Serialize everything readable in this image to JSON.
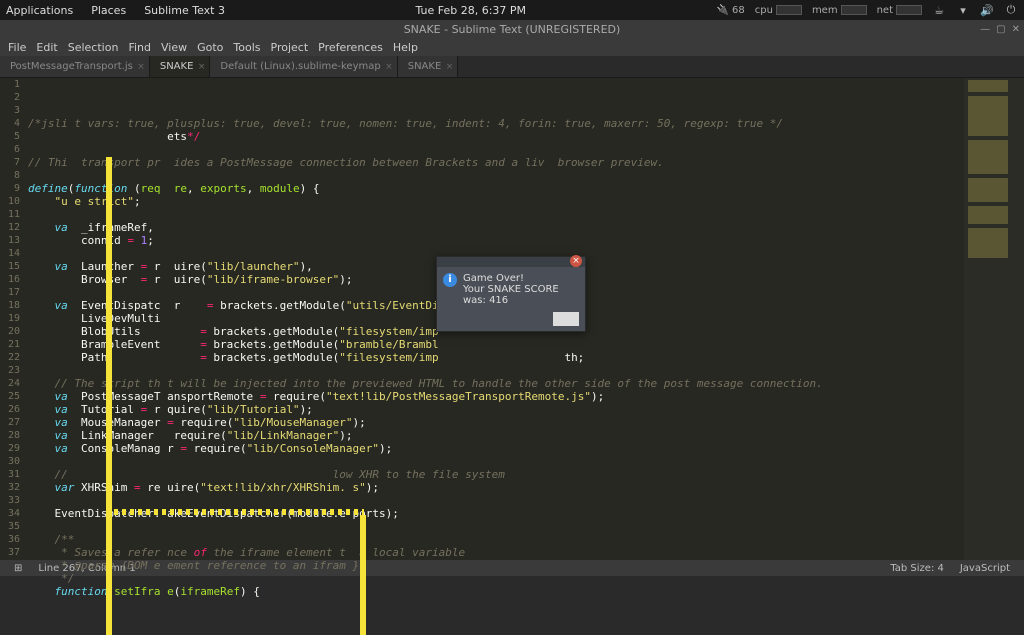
{
  "topbar": {
    "left": [
      "Applications",
      "Places",
      "Sublime Text 3"
    ],
    "clock": "Tue Feb 28,  6:37 PM",
    "battery": "68",
    "cpu_label": "cpu",
    "mem_label": "mem",
    "net_label": "net"
  },
  "window": {
    "title": "SNAKE - Sublime Text (UNREGISTERED)"
  },
  "menu": [
    "File",
    "Edit",
    "Selection",
    "Find",
    "View",
    "Goto",
    "Tools",
    "Project",
    "Preferences",
    "Help"
  ],
  "tabs": [
    {
      "label": "PostMessageTransport.js",
      "active": false
    },
    {
      "label": "SNAKE",
      "active": true
    },
    {
      "label": "Default (Linux).sublime-keymap",
      "active": false
    },
    {
      "label": "SNAKE",
      "active": false
    }
  ],
  "dialog": {
    "title": "Game Over!",
    "message": "Your SNAKE SCORE was: 416"
  },
  "status": {
    "left_icon": "⊞",
    "pos": "Line 267, Column 1",
    "tab": "Tab Size: 4",
    "lang": "JavaScript"
  },
  "code_lines": [
    {
      "n": 1,
      "h": "<span class='c-comment'>/*jsli t vars: true, plusplus: true, devel: true, nomen: true, indent: 4, forin: true, maxerr: 50, regexp: true */</span>"
    },
    {
      "n": 2,
      "h": "                     ets<span class='c-red'>*/</span>"
    },
    {
      "n": 3,
      "h": ""
    },
    {
      "n": 4,
      "h": "<span class='c-comment'>// Thi  transport pr  ides a PostMessage connection between Brackets and a liv  browser preview.</span>"
    },
    {
      "n": 5,
      "h": ""
    },
    {
      "n": 6,
      "h": "<span class='c-keyword'>define</span>(<span class='c-storage'>function</span> (<span class='c-name'>req  re</span>, <span class='c-name'>exports</span>, <span class='c-name'>module</span>) {"
    },
    {
      "n": 7,
      "h": "    <span class='c-string'>\"u e strict\"</span>;"
    },
    {
      "n": 8,
      "h": ""
    },
    {
      "n": 9,
      "h": "    <span class='c-storage'>va </span> _iframeRef,"
    },
    {
      "n": 10,
      "h": "        connId <span class='c-red'>=</span> <span class='c-num'>1</span>;"
    },
    {
      "n": 11,
      "h": ""
    },
    {
      "n": 12,
      "h": "    <span class='c-storage'>va </span> Launcher <span class='c-red'>=</span> r  uire(<span class='c-string'>\"lib/launcher\"</span>),"
    },
    {
      "n": 13,
      "h": "        Browser  <span class='c-red'>=</span> r  uire(<span class='c-string'>\"lib/iframe-browser\"</span>);"
    },
    {
      "n": 14,
      "h": ""
    },
    {
      "n": 15,
      "h": "    <span class='c-storage'>va </span> EventDispatc  r    <span class='c-red'>=</span> brackets.getModule(<span class='c-string'>\"utils/EventDis</span>"
    },
    {
      "n": 16,
      "h": "        LiveDevMulti"
    },
    {
      "n": 17,
      "h": "        BlobUtils         <span class='c-red'>=</span> brackets.getModule(<span class='c-string'>\"filesystem/imp </span>"
    },
    {
      "n": 18,
      "h": "        BrambleEvent      <span class='c-red'>=</span> brackets.getModule(<span class='c-string'>\"bramble/Brambl </span>"
    },
    {
      "n": 19,
      "h": "        Path              <span class='c-red'>=</span> brackets.getModule(<span class='c-string'>\"filesystem/imp </span>                  th;"
    },
    {
      "n": 20,
      "h": ""
    },
    {
      "n": 21,
      "h": "    <span class='c-comment'>// The script th t will be injected into the previewed HTML to handle the other side of the post message connection.</span>"
    },
    {
      "n": 22,
      "h": "    <span class='c-storage'>va </span> PostMessageT ansportRemote <span class='c-red'>=</span> require(<span class='c-string'>\"text!lib/PostMessageTransportRemote.js\"</span>);"
    },
    {
      "n": 23,
      "h": "    <span class='c-storage'>va </span> Tutorial <span class='c-red'>=</span> r quire(<span class='c-string'>\"lib/Tutorial\"</span>);"
    },
    {
      "n": 24,
      "h": "    <span class='c-storage'>va </span> MouseManager <span class='c-red'>=</span> require(<span class='c-string'>\"lib/MouseManager\"</span>);"
    },
    {
      "n": 25,
      "h": "    <span class='c-storage'>va </span> LinkManager   require(<span class='c-string'>\"lib/LinkManager\"</span>);"
    },
    {
      "n": 26,
      "h": "    <span class='c-storage'>va </span> ConsoleManag r <span class='c-red'>=</span> require(<span class='c-string'>\"lib/ConsoleManager\"</span>);"
    },
    {
      "n": 27,
      "h": ""
    },
    {
      "n": 28,
      "h": "    <span class='c-comment'>//                                        low XHR to the file system</span>"
    },
    {
      "n": 29,
      "h": "    <span class='c-storage'>var</span> XHRShim <span class='c-red'>=</span> re uire(<span class='c-string'>\"text!lib/xhr/XHRShim. s\"</span>);"
    },
    {
      "n": 30,
      "h": ""
    },
    {
      "n": 31,
      "h": "    EventDispatcher. akeEventDispatcher(module.e ports);"
    },
    {
      "n": 32,
      "h": ""
    },
    {
      "n": 33,
      "h": "    <span class='c-comment'>/**</span>"
    },
    {
      "n": 34,
      "h": "    <span class='c-comment'> * Saves a refer nce <span class='c-red'>of</span> the iframe element t  a local variable</span>"
    },
    {
      "n": 35,
      "h": "    <span class='c-comment'> * @param {DOM e ement reference to an ifram }</span>"
    },
    {
      "n": 36,
      "h": "    <span class='c-comment'> */</span>"
    },
    {
      "n": 37,
      "h": "    <span class='c-storage'>function</span> <span class='c-name'>setIfra e</span>(<span class='c-name'>iframeRef</span>) {"
    }
  ]
}
